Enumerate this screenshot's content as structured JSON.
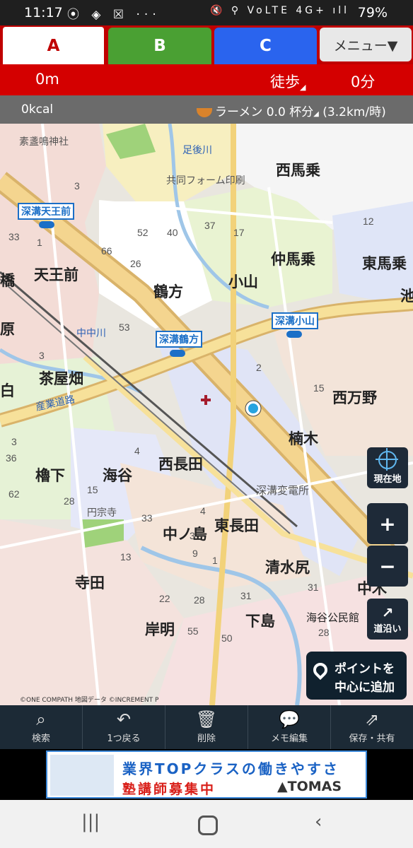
{
  "status_bar": {
    "time": "11:17",
    "left_icons": "⦿ ◈ ☒ ···",
    "right_icons": "🔇 ⚲ VoLTE 4G+ ıll",
    "battery": "79%"
  },
  "tabs": [
    {
      "label": "A"
    },
    {
      "label": "B"
    },
    {
      "label": "C"
    }
  ],
  "menu": {
    "label": "メニュー▼"
  },
  "info": {
    "distance": "0m",
    "mode": "徒歩",
    "duration": "0分"
  },
  "calorie": {
    "kcal": "0kcal",
    "ramen": "ラーメン 0.0 杯分",
    "speed": "(3.2km/時)"
  },
  "map": {
    "place_labels": [
      {
        "text": "素盞鳴神社",
        "cls": "small"
      },
      {
        "text": "足後川",
        "cls": "river"
      },
      {
        "text": "共同フォーム印刷",
        "cls": "small"
      },
      {
        "text": "西馬乗",
        "cls": "big"
      },
      {
        "text": "仲馬乗",
        "cls": "big"
      },
      {
        "text": "東馬乗",
        "cls": "big"
      },
      {
        "text": "天王前",
        "cls": "big"
      },
      {
        "text": "鶴方",
        "cls": "big"
      },
      {
        "text": "小山",
        "cls": "big"
      },
      {
        "text": "中中川",
        "cls": "river"
      },
      {
        "text": "茶屋畑",
        "cls": "big"
      },
      {
        "text": "産業道路",
        "cls": "river"
      },
      {
        "text": "西万野",
        "cls": "big"
      },
      {
        "text": "楠木",
        "cls": "big"
      },
      {
        "text": "西長田",
        "cls": "big"
      },
      {
        "text": "櫓下",
        "cls": "big"
      },
      {
        "text": "海谷",
        "cls": "big"
      },
      {
        "text": "深溝変電所",
        "cls": "small"
      },
      {
        "text": "円宗寺",
        "cls": "small"
      },
      {
        "text": "中ノ島",
        "cls": "big"
      },
      {
        "text": "東長田",
        "cls": "big"
      },
      {
        "text": "清水尻",
        "cls": "big"
      },
      {
        "text": "寺田",
        "cls": "big"
      },
      {
        "text": "下島",
        "cls": "big"
      },
      {
        "text": "海谷公民館",
        "cls": "small"
      },
      {
        "text": "岸明",
        "cls": "big"
      },
      {
        "text": "橋",
        "cls": "big"
      },
      {
        "text": "原",
        "cls": "big"
      },
      {
        "text": "白",
        "cls": "big"
      },
      {
        "text": "池",
        "cls": "big"
      },
      {
        "text": "中木",
        "cls": "big"
      }
    ],
    "stations": [
      {
        "text": "深溝天王前"
      },
      {
        "text": "深溝鶴方"
      },
      {
        "text": "深溝小山"
      }
    ],
    "numbers": [
      "3",
      "33",
      "1",
      "66",
      "26",
      "52",
      "40",
      "37",
      "17",
      "12",
      "53",
      "3",
      "2",
      "15",
      "4",
      "3",
      "36",
      "15",
      "28",
      "62",
      "4",
      "33",
      "3",
      "9",
      "1",
      "31",
      "22",
      "28",
      "31",
      "13",
      "55",
      "50",
      "28"
    ]
  },
  "controls": {
    "current_location": "現在地",
    "zoom_in": "+",
    "zoom_out": "−",
    "along_road": "道沿い",
    "add_point_l1": "ポイントを",
    "add_point_l2": "中心に追加"
  },
  "copyright": "©ONE COMPATH 地図データ ©INCREMENT P",
  "toolbar": [
    {
      "label": "検索",
      "icon": "search-icon"
    },
    {
      "label": "1つ戻る",
      "icon": "undo-icon"
    },
    {
      "label": "削除",
      "icon": "trash-icon"
    },
    {
      "label": "メモ編集",
      "icon": "memo-icon"
    },
    {
      "label": "保存・共有",
      "icon": "share-icon"
    }
  ],
  "ad": {
    "line1": "業界TOPクラスの働きやすさ",
    "line2": "塾講師募集中",
    "brand": "▲TOMAS"
  },
  "colors": {
    "tab_a": "#c00000",
    "tab_b": "#4aa033",
    "tab_c": "#2a64ee",
    "info": "#d40000",
    "toolbar": "#1c2a36"
  }
}
